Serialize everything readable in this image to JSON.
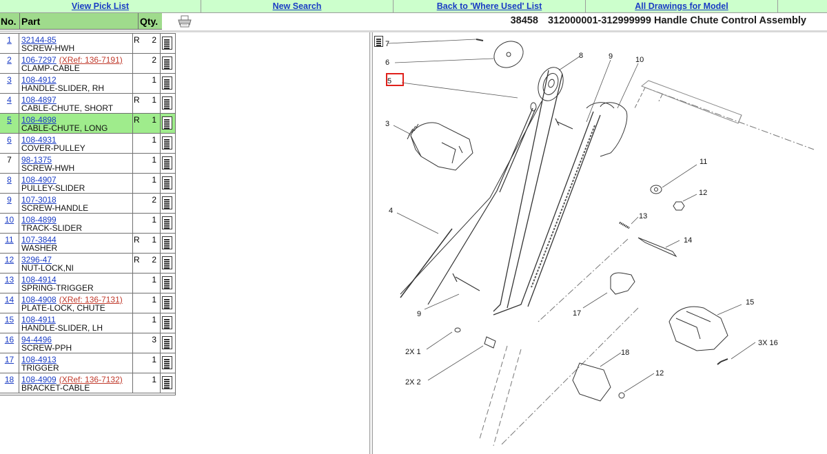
{
  "nav": {
    "pick_list": "View Pick List",
    "new_search": "New Search",
    "where_used": "Back to 'Where Used' List",
    "all_drawings": "All Drawings for Model"
  },
  "header": {
    "col_no": "No.",
    "col_part": "Part",
    "col_qty": "Qty.",
    "model": "38458",
    "title": "312000001-312999999 Handle Chute Control Assembly"
  },
  "parts": [
    {
      "no": "1",
      "part": "32144-85",
      "xref": "",
      "desc": "SCREW-HWH",
      "r": "R",
      "qty": "2",
      "linked": true
    },
    {
      "no": "2",
      "part": "106-7297",
      "xref": "(XRef: 136-7191)",
      "desc": "CLAMP-CABLE",
      "r": "",
      "qty": "2",
      "linked": true
    },
    {
      "no": "3",
      "part": "108-4912",
      "xref": "",
      "desc": "HANDLE-SLIDER, RH",
      "r": "",
      "qty": "1",
      "linked": true
    },
    {
      "no": "4",
      "part": "108-4897",
      "xref": "",
      "desc": "CABLE-CHUTE, SHORT",
      "r": "R",
      "qty": "1",
      "linked": true
    },
    {
      "no": "5",
      "part": "108-4898",
      "xref": "",
      "desc": "CABLE-CHUTE, LONG",
      "r": "R",
      "qty": "1",
      "linked": true,
      "selected": true
    },
    {
      "no": "6",
      "part": "108-4931",
      "xref": "",
      "desc": "COVER-PULLEY",
      "r": "",
      "qty": "1",
      "linked": true
    },
    {
      "no": "7",
      "part": "98-1375",
      "xref": "",
      "desc": "SCREW-HWH",
      "r": "",
      "qty": "1",
      "linked": false
    },
    {
      "no": "8",
      "part": "108-4907",
      "xref": "",
      "desc": "PULLEY-SLIDER",
      "r": "",
      "qty": "1",
      "linked": true
    },
    {
      "no": "9",
      "part": "107-3018",
      "xref": "",
      "desc": "SCREW-HANDLE",
      "r": "",
      "qty": "2",
      "linked": true
    },
    {
      "no": "10",
      "part": "108-4899",
      "xref": "",
      "desc": "TRACK-SLIDER",
      "r": "",
      "qty": "1",
      "linked": true
    },
    {
      "no": "11",
      "part": "107-3844",
      "xref": "",
      "desc": "WASHER",
      "r": "R",
      "qty": "1",
      "linked": true
    },
    {
      "no": "12",
      "part": "3296-47",
      "xref": "",
      "desc": "NUT-LOCK,NI",
      "r": "R",
      "qty": "2",
      "linked": true
    },
    {
      "no": "13",
      "part": "108-4914",
      "xref": "",
      "desc": "SPRING-TRIGGER",
      "r": "",
      "qty": "1",
      "linked": true
    },
    {
      "no": "14",
      "part": "108-4908",
      "xref": "(XRef: 136-7131)",
      "desc": "PLATE-LOCK, CHUTE",
      "r": "",
      "qty": "1",
      "linked": true
    },
    {
      "no": "15",
      "part": "108-4911",
      "xref": "",
      "desc": "HANDLE-SLIDER, LH",
      "r": "",
      "qty": "1",
      "linked": true
    },
    {
      "no": "16",
      "part": "94-4496",
      "xref": "",
      "desc": "SCREW-PPH",
      "r": "",
      "qty": "3",
      "linked": true
    },
    {
      "no": "17",
      "part": "108-4913",
      "xref": "",
      "desc": "TRIGGER",
      "r": "",
      "qty": "1",
      "linked": true
    },
    {
      "no": "18",
      "part": "108-4909",
      "xref": "(XRef: 136-7132)",
      "desc": "BRACKET-CABLE",
      "r": "",
      "qty": "1",
      "linked": true
    }
  ],
  "diagram": {
    "callouts": [
      "7",
      "6",
      "5",
      "8",
      "9",
      "10",
      "3",
      "11",
      "12",
      "4",
      "13",
      "14",
      "9",
      "17",
      "15",
      "3X 16",
      "2X 1",
      "18",
      "2X 2",
      "12"
    ],
    "highlight": "#e0201b"
  }
}
